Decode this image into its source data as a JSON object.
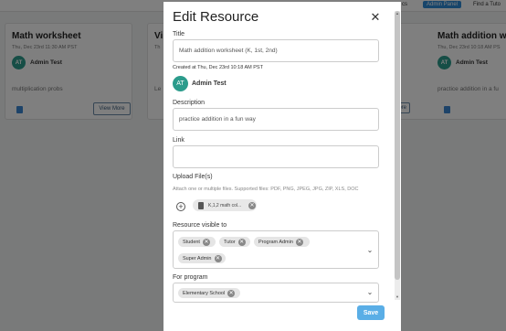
{
  "background": {
    "top_nav": {
      "item_partial": "cs",
      "admin_panel": "Admin Panel",
      "find_tutor": "Find a Tuto"
    },
    "cards": [
      {
        "title": "Math worksheet",
        "date": "Thu, Dec 23rd 11:30 AM PST",
        "avatar_initials": "AT",
        "author": "Admin Test",
        "description": "multiplication probs",
        "button": "View More"
      },
      {
        "title": "Vi",
        "date": "Th",
        "avatar_initials": "",
        "author": "",
        "description": "Le",
        "button": ""
      },
      {
        "title": "Math addition wo",
        "date": "Thu, Dec 23rd 10:18 AM PS",
        "avatar_initials": "AT",
        "author": "Admin Test",
        "description": "practice addition in a fu",
        "button": "ore"
      }
    ]
  },
  "modal": {
    "title": "Edit Resource",
    "close_icon": "close-icon",
    "title_label": "Title",
    "title_value": "Math addition worksheet (K, 1st, 2nd)",
    "created_at": "Created at Thu, Dec 23rd 10:18 AM PST",
    "avatar_initials": "AT",
    "author": "Admin Test",
    "description_label": "Description",
    "description_value": "practice addition in a fun way",
    "link_label": "Link",
    "link_value": "",
    "upload_label": "Upload File(s)",
    "upload_hint": "Attach one or multiple files. Supported files: PDF, PNG, JPEG, JPG, ZIP, XLS, DOC",
    "file_name": "K,1,2 math col...",
    "visible_label": "Resource visible to",
    "visible_to": [
      "Student",
      "Tutor",
      "Program Admin",
      "Super Admin"
    ],
    "program_label": "For program",
    "programs": [
      "Elementary School"
    ],
    "save_label": "Save"
  },
  "colors": {
    "accent": "#5aaee6",
    "avatar": "#2c9c8c",
    "admin_nav": "#2f8bd6"
  }
}
